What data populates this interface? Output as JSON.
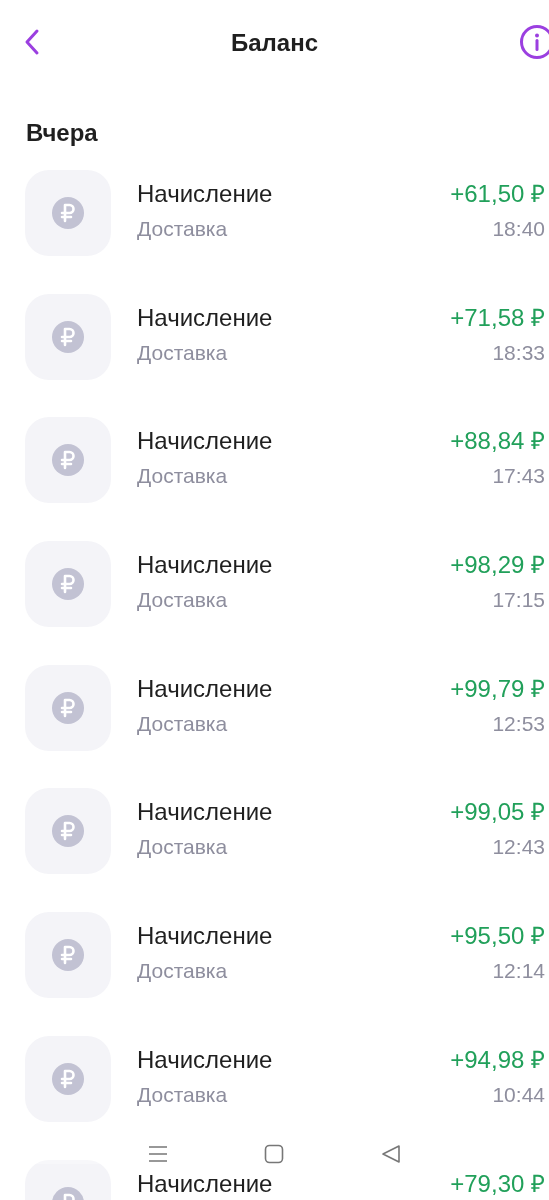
{
  "header": {
    "title": "Баланс"
  },
  "section": {
    "title": "Вчера"
  },
  "rows": [
    {
      "title": "Начисление",
      "subtitle": "Доставка",
      "amount": "+61,50 ₽",
      "time": "18:40"
    },
    {
      "title": "Начисление",
      "subtitle": "Доставка",
      "amount": "+71,58 ₽",
      "time": "18:33"
    },
    {
      "title": "Начисление",
      "subtitle": "Доставка",
      "amount": "+88,84 ₽",
      "time": "17:43"
    },
    {
      "title": "Начисление",
      "subtitle": "Доставка",
      "amount": "+98,29 ₽",
      "time": "17:15"
    },
    {
      "title": "Начисление",
      "subtitle": "Доставка",
      "amount": "+99,79 ₽",
      "time": "12:53"
    },
    {
      "title": "Начисление",
      "subtitle": "Доставка",
      "amount": "+99,05 ₽",
      "time": "12:43"
    },
    {
      "title": "Начисление",
      "subtitle": "Доставка",
      "amount": "+95,50 ₽",
      "time": "12:14"
    },
    {
      "title": "Начисление",
      "subtitle": "Доставка",
      "amount": "+94,98 ₽",
      "time": "10:44"
    },
    {
      "title": "Начисление",
      "amount": "+79,30 ₽"
    }
  ]
}
